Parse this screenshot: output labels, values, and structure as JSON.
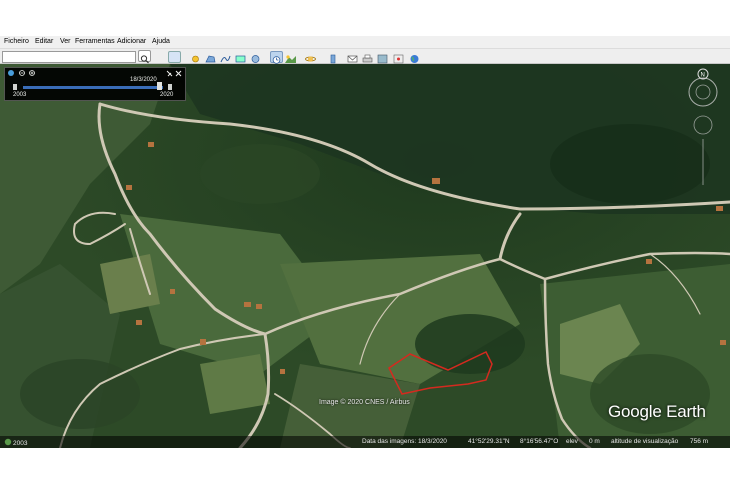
{
  "menu": [
    "Ficheiro",
    "Editar",
    "Ver",
    "Ferramentas",
    "Adicionar",
    "Ajuda"
  ],
  "time_slider": {
    "current_date": "18/3/2020",
    "start_year": "2003",
    "end_year": "2020"
  },
  "map": {
    "copyright": "Image © 2020 CNES / Airbus",
    "brand": "Google Earth",
    "outline_color": "#d42a1f",
    "road_color": "#cfc8b4"
  },
  "status": {
    "history_year": "2003",
    "imagery_date": "Data das imagens: 18/3/2020",
    "latitude": "41°52'29.31\"N",
    "longitude": "8°16'56.47\"O",
    "elevation": "elev",
    "elevation_value": "0 m",
    "eye_alt": "altitude de visualização",
    "eye_alt_value": "756 m"
  }
}
